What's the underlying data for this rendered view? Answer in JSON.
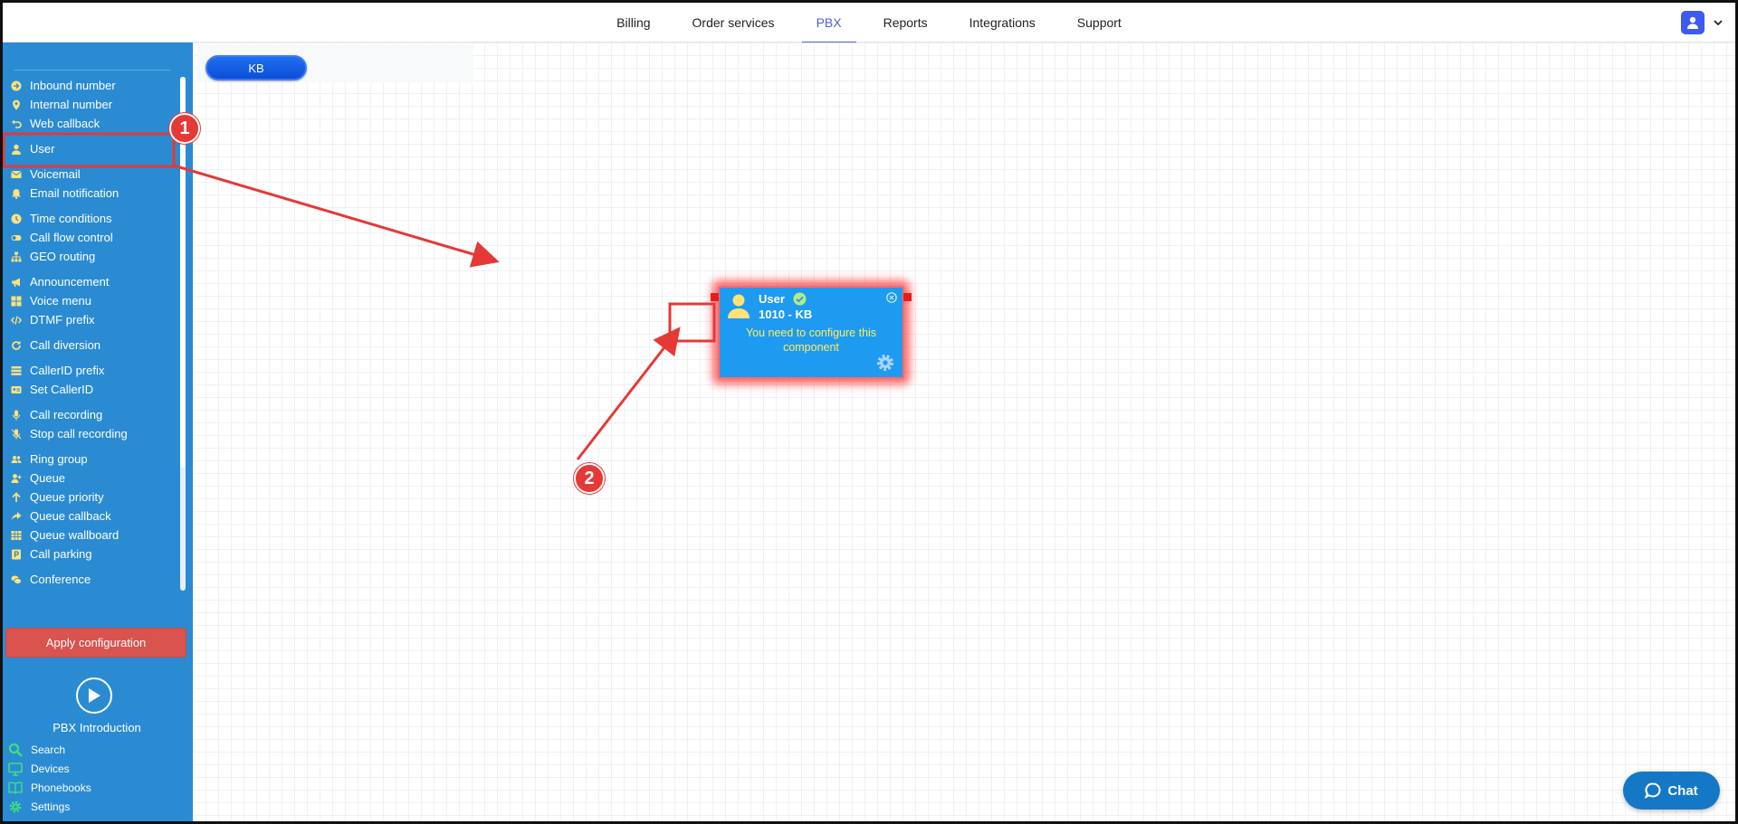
{
  "topnav": {
    "tabs": [
      {
        "label": "Billing"
      },
      {
        "label": "Order services"
      },
      {
        "label": "PBX"
      },
      {
        "label": "Reports"
      },
      {
        "label": "Integrations"
      },
      {
        "label": "Support"
      }
    ],
    "active_tab": "PBX"
  },
  "sidebar": {
    "items": [
      {
        "label": "Inbound number",
        "icon": "arrow-circle-icon"
      },
      {
        "label": "Internal number",
        "icon": "location-pin-icon"
      },
      {
        "label": "Web callback",
        "icon": "undo-icon"
      },
      {
        "label": "User",
        "icon": "user-icon"
      },
      {
        "label": "Voicemail",
        "icon": "envelope-icon"
      },
      {
        "label": "Email notification",
        "icon": "bell-icon"
      },
      {
        "label": "Time conditions",
        "icon": "clock-icon"
      },
      {
        "label": "Call flow control",
        "icon": "toggle-icon"
      },
      {
        "label": "GEO routing",
        "icon": "sitemap-icon"
      },
      {
        "label": "Announcement",
        "icon": "megaphone-icon"
      },
      {
        "label": "Voice menu",
        "icon": "grid-icon"
      },
      {
        "label": "DTMF prefix",
        "icon": "code-icon"
      },
      {
        "label": "Call diversion",
        "icon": "redo-icon"
      },
      {
        "label": "CallerID prefix",
        "icon": "list-icon"
      },
      {
        "label": "Set CallerID",
        "icon": "id-card-icon"
      },
      {
        "label": "Call recording",
        "icon": "microphone-icon"
      },
      {
        "label": "Stop call recording",
        "icon": "microphone-slash-icon"
      },
      {
        "label": "Ring group",
        "icon": "users-icon"
      },
      {
        "label": "Queue",
        "icon": "user-plus-icon"
      },
      {
        "label": "Queue priority",
        "icon": "arrow-up-icon"
      },
      {
        "label": "Queue callback",
        "icon": "share-icon"
      },
      {
        "label": "Queue wallboard",
        "icon": "table-icon"
      },
      {
        "label": "Call parking",
        "icon": "parking-icon"
      },
      {
        "label": "Conference",
        "icon": "comments-icon"
      }
    ],
    "apply_label": "Apply configuration",
    "intro_label": "PBX Introduction",
    "tools": [
      {
        "label": "Search",
        "icon": "search-icon"
      },
      {
        "label": "Devices",
        "icon": "monitor-icon"
      },
      {
        "label": "Phonebooks",
        "icon": "book-icon"
      },
      {
        "label": "Settings",
        "icon": "gear-icon"
      }
    ]
  },
  "canvas": {
    "kb_label": "KB",
    "component": {
      "title": "User",
      "subtitle": "1010 - KB",
      "warning": "You need to configure this component"
    }
  },
  "annotations": {
    "marker1": "1",
    "marker2": "2",
    "color": "#e53935"
  },
  "chat": {
    "label": "Chat"
  },
  "colors": {
    "sidebar": "#2a8bd3",
    "accent": "#4e5fd8",
    "apply": "#d9534f",
    "component": "#1e9af0"
  }
}
